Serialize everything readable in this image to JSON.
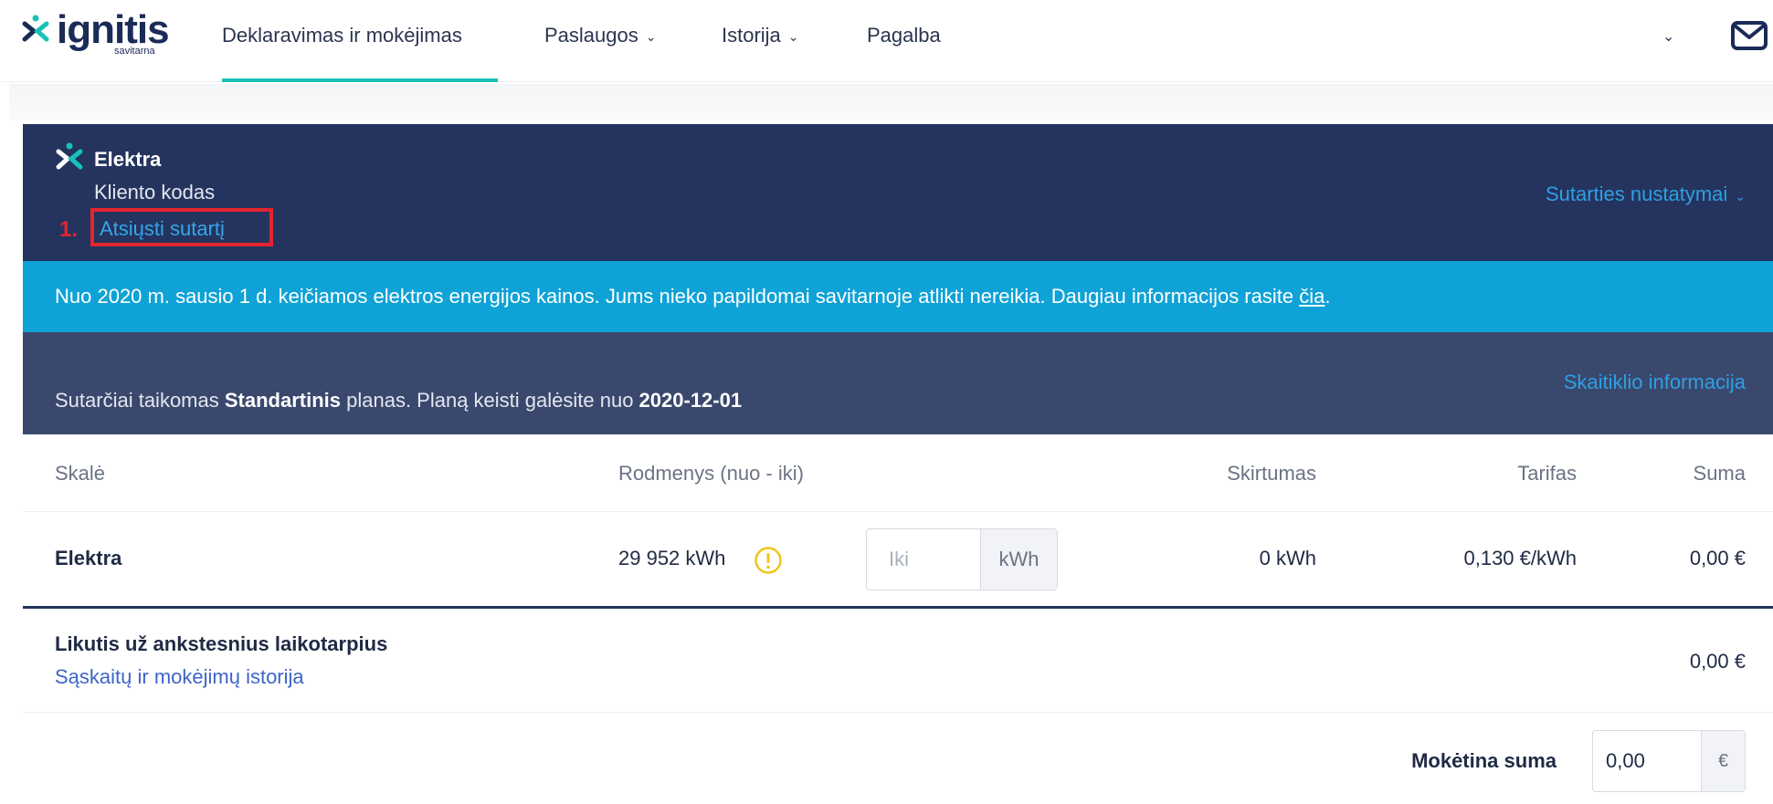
{
  "brand": {
    "name": "ignitis",
    "subtitle": "savitarna"
  },
  "nav": {
    "items": [
      {
        "label": "Deklaravimas ir mokėjimas",
        "active": true
      },
      {
        "label": "Paslaugos",
        "dropdown": true
      },
      {
        "label": "Istorija",
        "dropdown": true
      },
      {
        "label": "Pagalba"
      }
    ],
    "icons": {
      "account_menu": "chevron-down-icon",
      "messages": "envelope-icon"
    }
  },
  "contract": {
    "title": "Elektra",
    "client_code_label": "Kliento kodas",
    "step_marker": "1.",
    "download_label": "Atsiųsti sutartį",
    "settings_label": "Sutarties nustatymai"
  },
  "notice": {
    "text": "Nuo 2020 m. sausio 1 d. keičiamos elektros energijos kainos. Jums nieko papildomai savitarnoje atlikti nereikia. Daugiau informacijos rasite ",
    "link_label": "čia",
    "suffix": "."
  },
  "plan": {
    "prefix": "Sutarčiai taikomas ",
    "plan_name": "Standartinis",
    "middle": " planas.   Planą keisti galėsite nuo ",
    "change_date": "2020-12-01",
    "meter_info_label": "Skaitiklio informacija"
  },
  "table": {
    "headers": {
      "scale": "Skalė",
      "readings": "Rodmenys (nuo - iki)",
      "difference": "Skirtumas",
      "tariff": "Tarifas",
      "sum": "Suma"
    },
    "rows": [
      {
        "scale": "Elektra",
        "reading_from": "29 952 kWh",
        "reading_to_value": "",
        "reading_to_placeholder": "Iki",
        "reading_unit": "kWh",
        "difference": "0 kWh",
        "tariff": "0,130 €/kWh",
        "sum": "0,00 €"
      }
    ]
  },
  "balance": {
    "label": "Likutis už ankstesnius laikotarpius",
    "history_link": "Sąskaitų ir mokėjimų istorija",
    "amount": "0,00 €"
  },
  "total": {
    "label": "Mokėtina suma",
    "value": "0,00",
    "currency": "€"
  },
  "colors": {
    "header_bg": "#24345e",
    "notice_bg": "#0fa2d6",
    "plan_bg": "#3a486d",
    "accent": "#18c2b8",
    "link": "#2f9fe3",
    "highlight": "#e4242f",
    "warning": "#f0c419"
  }
}
